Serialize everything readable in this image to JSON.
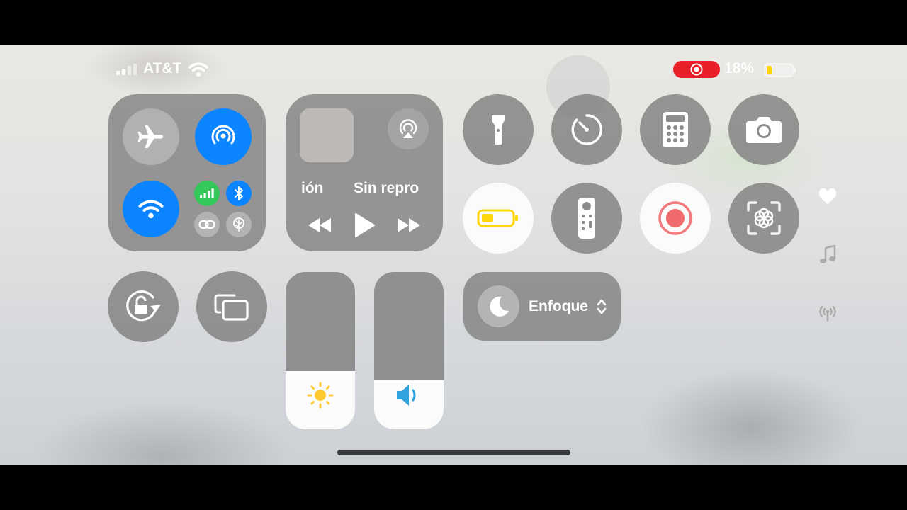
{
  "status_bar": {
    "carrier": "AT&T",
    "battery_percent": "18%",
    "battery_level": 0.18,
    "recording_indicator_color": "#e8202a"
  },
  "connectivity": {
    "airplane_mode": "off",
    "airdrop": "on",
    "wifi": "on",
    "cellular_data": "on",
    "bluetooth": "on",
    "colors": {
      "accent_blue": "#0a84ff",
      "cellular_green": "#34c759"
    }
  },
  "media": {
    "text_left": "ión",
    "text_right": "Sin repro"
  },
  "sliders": {
    "brightness_level": 0.37,
    "volume_level": 0.31
  },
  "focus": {
    "label": "Enfoque"
  },
  "side_icons": [
    "heart-icon",
    "music-note-icon",
    "broadcast-icon"
  ]
}
